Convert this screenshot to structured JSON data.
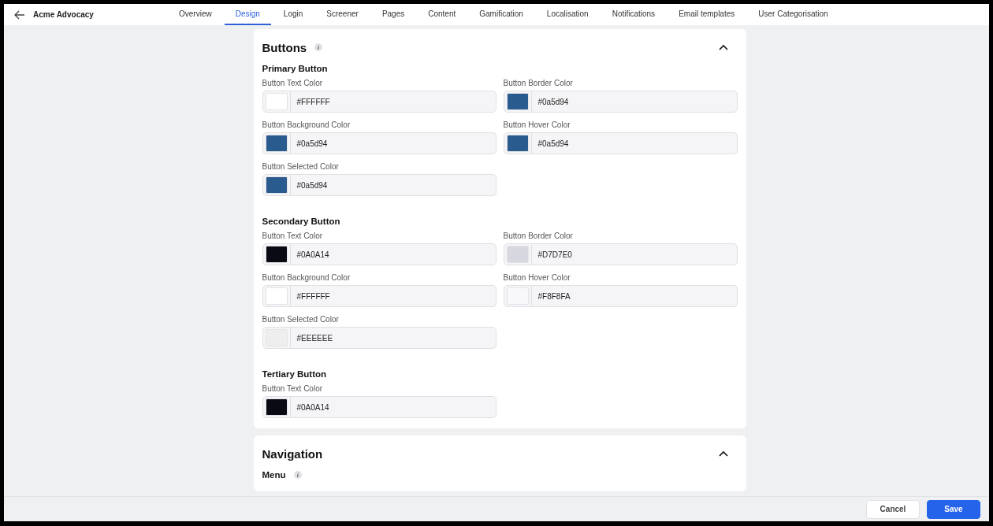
{
  "header": {
    "title": "Acme Advocacy"
  },
  "tabs": [
    {
      "label": "Overview",
      "selected": false
    },
    {
      "label": "Design",
      "selected": true
    },
    {
      "label": "Login",
      "selected": false
    },
    {
      "label": "Screener",
      "selected": false
    },
    {
      "label": "Pages",
      "selected": false
    },
    {
      "label": "Content",
      "selected": false
    },
    {
      "label": "Gamification",
      "selected": false
    },
    {
      "label": "Localisation",
      "selected": false
    },
    {
      "label": "Notifications",
      "selected": false
    },
    {
      "label": "Email templates",
      "selected": false
    },
    {
      "label": "User Categorisation",
      "selected": false
    }
  ],
  "sections": [
    {
      "title": "Buttons",
      "info": true,
      "expanded": true,
      "groups": [
        {
          "title": "Primary Button",
          "info": false,
          "fields": [
            {
              "label": "Button Text Color",
              "value": "#FFFFFF",
              "color": "#ffffff"
            },
            {
              "label": "Button Border Color",
              "value": "#0a5d94",
              "color": "#2a5b8e"
            },
            {
              "label": "Button Background Color",
              "value": "#0a5d94",
              "color": "#2a5b8e"
            },
            {
              "label": "Button Hover Color",
              "value": "#0a5d94",
              "color": "#2a5b8e"
            },
            {
              "label": "Button Selected Color",
              "value": "#0a5d94",
              "color": "#2a5b8e"
            }
          ]
        },
        {
          "title": "Secondary Button",
          "info": false,
          "fields": [
            {
              "label": "Button Text Color",
              "value": "#0A0A14",
              "color": "#0a0a14"
            },
            {
              "label": "Button Border Color",
              "value": "#D7D7E0",
              "color": "#d7d7e0"
            },
            {
              "label": "Button Background Color",
              "value": "#FFFFFF",
              "color": "#ffffff"
            },
            {
              "label": "Button Hover Color",
              "value": "#F8F8FA",
              "color": "#f8f8fa"
            },
            {
              "label": "Button Selected Color",
              "value": "#EEEEEE",
              "color": "#eeeeee"
            }
          ]
        },
        {
          "title": "Tertiary Button",
          "info": false,
          "fields": [
            {
              "label": "Button Text Color",
              "value": "#0A0A14",
              "color": "#0a0a14"
            }
          ]
        }
      ]
    },
    {
      "title": "Navigation",
      "info": false,
      "expanded": true,
      "groups": [
        {
          "title": "Menu",
          "info": true
        }
      ]
    }
  ],
  "footer": {
    "buttons": [
      {
        "label": "Cancel",
        "kind": "secondary"
      },
      {
        "label": "Save",
        "kind": "primary"
      }
    ]
  }
}
